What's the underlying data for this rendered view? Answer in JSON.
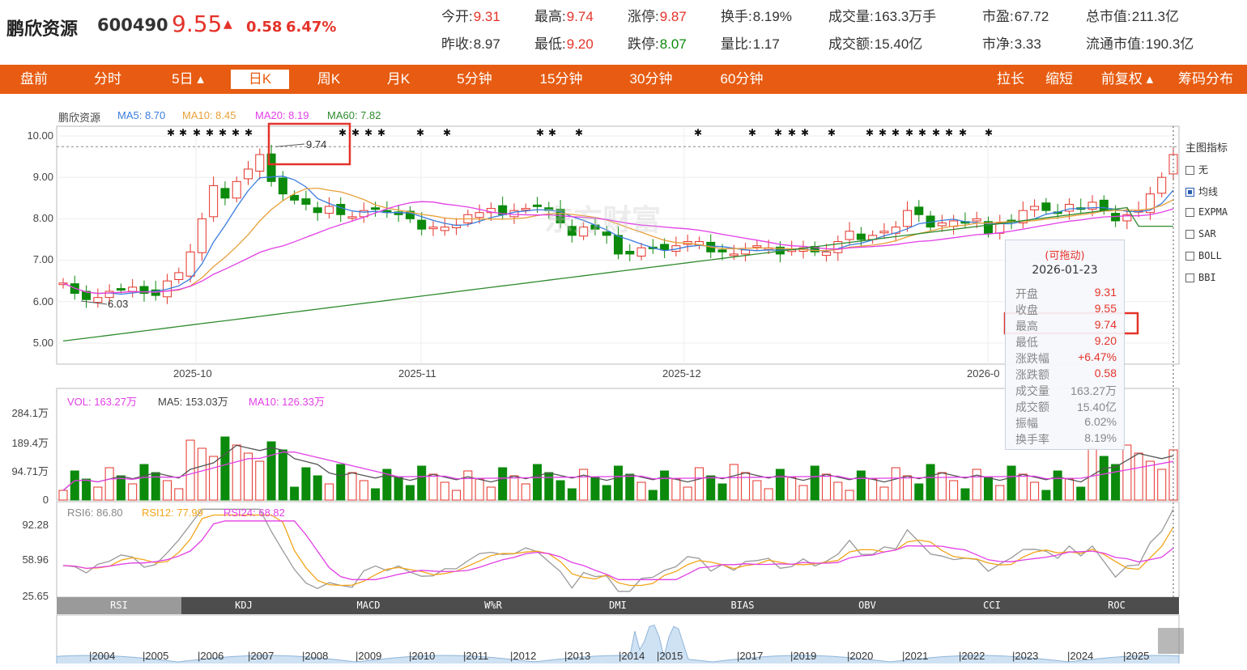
{
  "header": {
    "name": "鹏欣资源",
    "code": "600490",
    "price": "9.55",
    "arrow": "▲",
    "change": "0.58",
    "change_pct": "6.47%"
  },
  "quotes": [
    {
      "label": "今开:",
      "value": "9.31",
      "color": "red"
    },
    {
      "label": "昨收:",
      "value": "8.97",
      "color": "normal"
    },
    {
      "label": "最高:",
      "value": "9.74",
      "color": "red"
    },
    {
      "label": "最低:",
      "value": "9.20",
      "color": "red"
    },
    {
      "label": "涨停:",
      "value": "9.87",
      "color": "red"
    },
    {
      "label": "跌停:",
      "value": "8.07",
      "color": "green"
    },
    {
      "label": "换手:",
      "value": "8.19%",
      "color": "normal"
    },
    {
      "label": "量比:",
      "value": "1.17",
      "color": "normal"
    },
    {
      "label": "成交量:",
      "value": "163.3万手",
      "color": "normal"
    },
    {
      "label": "成交额:",
      "value": "15.40亿",
      "color": "normal"
    },
    {
      "label": "市盈:",
      "value": "67.72",
      "color": "normal"
    },
    {
      "label": "市净:",
      "value": "3.33",
      "color": "normal"
    },
    {
      "label": "总市值:",
      "value": "211.3亿",
      "color": "normal"
    },
    {
      "label": "流通市值:",
      "value": "190.3亿",
      "color": "normal"
    }
  ],
  "tabs": [
    "盘前",
    "分时",
    "5日 ▴",
    "日K",
    "周K",
    "月K",
    "5分钟",
    "15分钟",
    "30分钟",
    "60分钟"
  ],
  "active_tab": "日K",
  "right_tabs": [
    "拉长",
    "缩短",
    "前复权 ▴",
    "筹码分布"
  ],
  "main_legend": {
    "name": "鹏欣资源",
    "ma5": "MA5: 8.70",
    "ma10": "MA10: 8.45",
    "ma20": "MA20: 8.19",
    "ma60": "MA60: 7.82"
  },
  "colors": {
    "up": "#e4332a",
    "down": "#0b8a0b",
    "ma5": "#3b7ddd",
    "ma10": "#e8a03a",
    "ma20": "#e23fe6",
    "ma60": "#2e8b2e",
    "accent": "#e75c12",
    "vol": "#e23fe6",
    "rsi6": "#999999",
    "rsi12": "#f2a51a",
    "rsi24": "#e23fe6"
  },
  "price_axis": [
    "10.00",
    "9.00",
    "8.00",
    "7.00",
    "6.00",
    "5.00"
  ],
  "date_axis": [
    "2025-10",
    "2025-11",
    "2025-12",
    "2026-0"
  ],
  "annotations": {
    "high": "9.74",
    "low": "6.03"
  },
  "watermark": "东方财富",
  "side_panel": {
    "title": "主图指标",
    "items": [
      {
        "label": "无",
        "checked": false
      },
      {
        "label": "均线",
        "checked": true
      },
      {
        "label": "EXPMA",
        "checked": false
      },
      {
        "label": "SAR",
        "checked": false
      },
      {
        "label": "BOLL",
        "checked": false
      },
      {
        "label": "BBI",
        "checked": false
      }
    ]
  },
  "tooltip": {
    "hint": "(可拖动)",
    "date": "2026-01-23",
    "rows": [
      {
        "k": "开盘",
        "v": "9.31",
        "color": "red"
      },
      {
        "k": "收盘",
        "v": "9.55",
        "color": "red"
      },
      {
        "k": "最高",
        "v": "9.74",
        "color": "red"
      },
      {
        "k": "最低",
        "v": "9.20",
        "color": "red"
      },
      {
        "k": "涨跌幅",
        "v": "+6.47%",
        "color": "red"
      },
      {
        "k": "涨跌额",
        "v": "0.58",
        "color": "red"
      },
      {
        "k": "成交量",
        "v": "163.27万",
        "color": "gray"
      },
      {
        "k": "成交额",
        "v": "15.40亿",
        "color": "gray"
      },
      {
        "k": "振幅",
        "v": "6.02%",
        "color": "gray"
      },
      {
        "k": "换手率",
        "v": "8.19%",
        "color": "gray"
      }
    ]
  },
  "volume_legend": {
    "vol": "VOL: 163.27万",
    "ma5": "MA5: 153.03万",
    "ma10": "MA10: 126.33万"
  },
  "volume_axis": [
    "284.1万",
    "189.4万",
    "94.71万",
    "0"
  ],
  "rsi_legend": {
    "rsi6": "RSI6: 86.80",
    "rsi12": "RSI12: 77.99",
    "rsi24": "RSI24: 68.82"
  },
  "rsi_axis": [
    "92.28",
    "58.96",
    "25.65"
  ],
  "indicator_tabs": [
    "RSI",
    "KDJ",
    "MACD",
    "W%R",
    "DMI",
    "BIAS",
    "OBV",
    "CCI",
    "ROC"
  ],
  "active_indicator": "RSI",
  "years": [
    "2004",
    "2005",
    "2006",
    "2007",
    "2008",
    "2009",
    "2010",
    "2011",
    "2012",
    "2013",
    "2014",
    "2015",
    "2017",
    "2019",
    "2020",
    "2021",
    "2022",
    "2023",
    "2024",
    "2025"
  ]
}
